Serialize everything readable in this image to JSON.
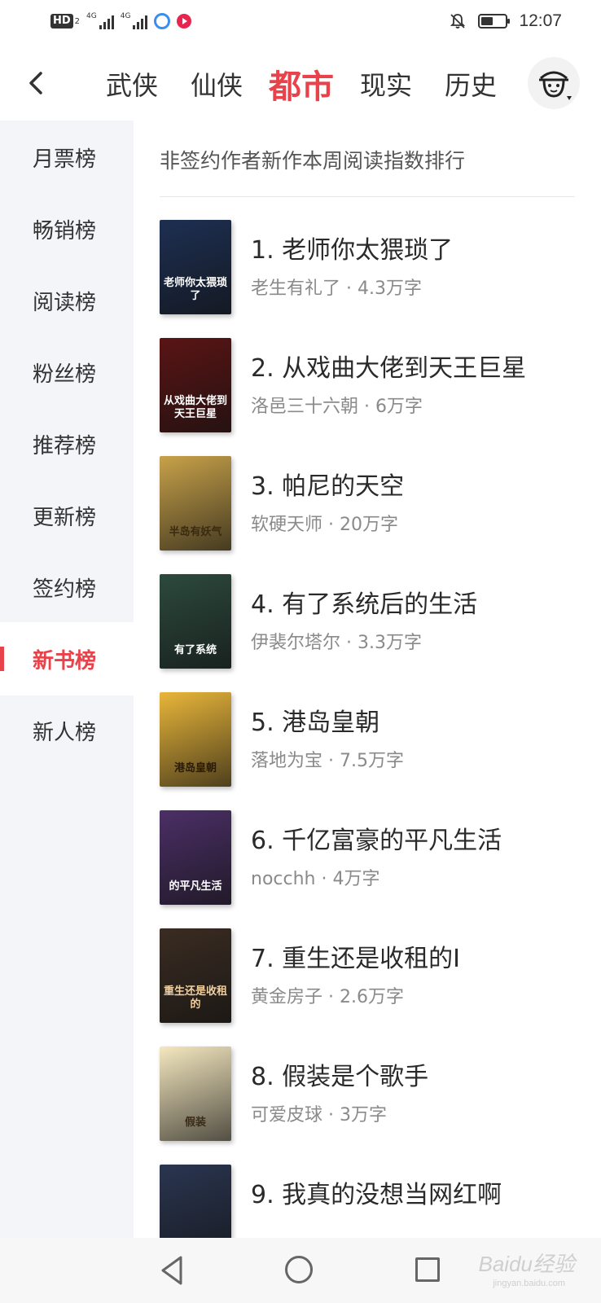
{
  "status_bar": {
    "hd_label": "HD",
    "hd_sub": "2",
    "signal1_label": "4G",
    "signal2_label": "4G",
    "time": "12:07",
    "battery_level": 0.5
  },
  "header": {
    "tabs": [
      {
        "label": "武侠"
      },
      {
        "label": "仙侠"
      },
      {
        "label": "都市",
        "active": true
      },
      {
        "label": "现实"
      },
      {
        "label": "历史"
      }
    ]
  },
  "sidebar": {
    "items": [
      {
        "label": "月票榜"
      },
      {
        "label": "畅销榜"
      },
      {
        "label": "阅读榜"
      },
      {
        "label": "粉丝榜"
      },
      {
        "label": "推荐榜"
      },
      {
        "label": "更新榜"
      },
      {
        "label": "签约榜"
      },
      {
        "label": "新书榜",
        "active": true
      },
      {
        "label": "新人榜"
      }
    ]
  },
  "main": {
    "subtitle": "非签约作者新作本周阅读指数排行",
    "books": [
      {
        "title": "1. 老师你太猥琐了",
        "meta": "老生有礼了 · 4.3万字",
        "cover_text": "老师你太猥琐了",
        "cover_bg": "#1d2f52",
        "cover_fg": "#ffffff"
      },
      {
        "title": "2. 从戏曲大佬到天王巨星",
        "meta": "洛邑三十六朝 · 6万字",
        "cover_text": "从戏曲大佬到天王巨星",
        "cover_bg": "#5a1414",
        "cover_fg": "#ffffff"
      },
      {
        "title": "3. 帕尼的天空",
        "meta": "软硬天师 · 20万字",
        "cover_text": "半岛有妖气",
        "cover_bg": "#c8a24a",
        "cover_fg": "#3a2a10"
      },
      {
        "title": "4. 有了系统后的生活",
        "meta": "伊裴尔塔尔 · 3.3万字",
        "cover_text": "有了系统",
        "cover_bg": "#2c4a3e",
        "cover_fg": "#ffffff"
      },
      {
        "title": "5. 港岛皇朝",
        "meta": "落地为宝 · 7.5万字",
        "cover_text": "港岛皇朝",
        "cover_bg": "#e9b63a",
        "cover_fg": "#2a1a08"
      },
      {
        "title": "6. 千亿富豪的平凡生活",
        "meta": "nocchh · 4万字",
        "cover_text": "的平凡生活",
        "cover_bg": "#4b2f66",
        "cover_fg": "#ffffff"
      },
      {
        "title": "7. 重生还是收租的I",
        "meta": "黄金房子 · 2.6万字",
        "cover_text": "重生还是收租的",
        "cover_bg": "#3a2c22",
        "cover_fg": "#f0d0a0"
      },
      {
        "title": "8. 假装是个歌手",
        "meta": "可爱皮球 · 3万字",
        "cover_text": "假装",
        "cover_bg": "#f5e8c0",
        "cover_fg": "#3a2a18"
      },
      {
        "title": "9. 我真的没想当网红啊",
        "meta": "",
        "cover_text": "",
        "cover_bg": "#2a3550",
        "cover_fg": "#ffffff"
      }
    ]
  },
  "watermark": {
    "text": "Baidu经验",
    "sub": "jingyan.baidu.com"
  },
  "colors": {
    "accent": "#e8434a",
    "sidebar_bg": "#f4f5f9"
  }
}
